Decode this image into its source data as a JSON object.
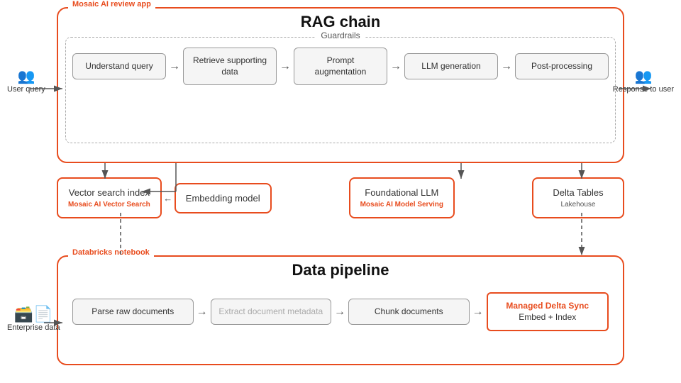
{
  "rag": {
    "section_label": "Mosaic AI review app",
    "title": "RAG chain",
    "guardrails": "Guardrails",
    "processes": [
      {
        "id": "understand-query",
        "label": "Understand query"
      },
      {
        "id": "retrieve-data",
        "label": "Retrieve supporting data"
      },
      {
        "id": "prompt-aug",
        "label": "Prompt augmentation"
      },
      {
        "id": "llm-gen",
        "label": "LLM generation"
      },
      {
        "id": "post-proc",
        "label": "Post-processing"
      }
    ],
    "user_query": "User query",
    "response": "Response to user"
  },
  "middle": {
    "vector_search": {
      "label": "Vector search index",
      "sublabel": "Mosaic AI Vector Search"
    },
    "embedding": {
      "label": "Embedding model"
    },
    "foundational": {
      "label": "Foundational LLM",
      "sublabel": "Mosaic AI Model Serving"
    },
    "delta_tables": {
      "label": "Delta Tables",
      "sublabel": "Lakehouse"
    }
  },
  "pipeline": {
    "section_label": "Databricks notebook",
    "title": "Data pipeline",
    "processes": [
      {
        "id": "parse-docs",
        "label": "Parse raw documents",
        "highlighted": false
      },
      {
        "id": "extract-meta",
        "label": "Extract document metadata",
        "highlighted": false,
        "muted": true
      },
      {
        "id": "chunk-docs",
        "label": "Chunk documents",
        "highlighted": false
      },
      {
        "id": "managed-delta",
        "label": "Managed Delta Sync\nEmbed + Index",
        "highlighted": true
      }
    ],
    "enterprise_data": "Enterprise data"
  },
  "colors": {
    "accent": "#e84c1e",
    "border_gray": "#999999",
    "bg_box": "#f5f5f5",
    "text_dark": "#333333",
    "text_muted": "#888888"
  }
}
